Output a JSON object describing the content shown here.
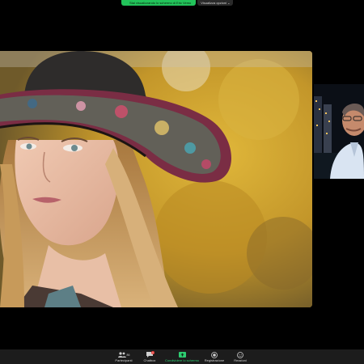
{
  "share_banner": {
    "status": "Stai visualizzando lo schermo di Eric Vemo",
    "view_options": "Visualizza opzioni"
  },
  "shared_screen": {
    "description_colors": {
      "bg": "#c9a12c",
      "hat": "#2e2c2b",
      "hair": "#b98a4e"
    }
  },
  "participant": {
    "name": ""
  },
  "toolbar": {
    "participants": {
      "label": "Partecipanti",
      "count": "86"
    },
    "chat": {
      "label": "Chatbox",
      "badge": "1"
    },
    "share": {
      "label": "Condividere lo schermo"
    },
    "record": {
      "label": "Registrazione"
    },
    "reactions": {
      "label": "Reazioni"
    }
  },
  "colors": {
    "accent_green": "#22c35a",
    "toolbar_bg": "#1c1c1c",
    "alert_red": "#e53935"
  }
}
